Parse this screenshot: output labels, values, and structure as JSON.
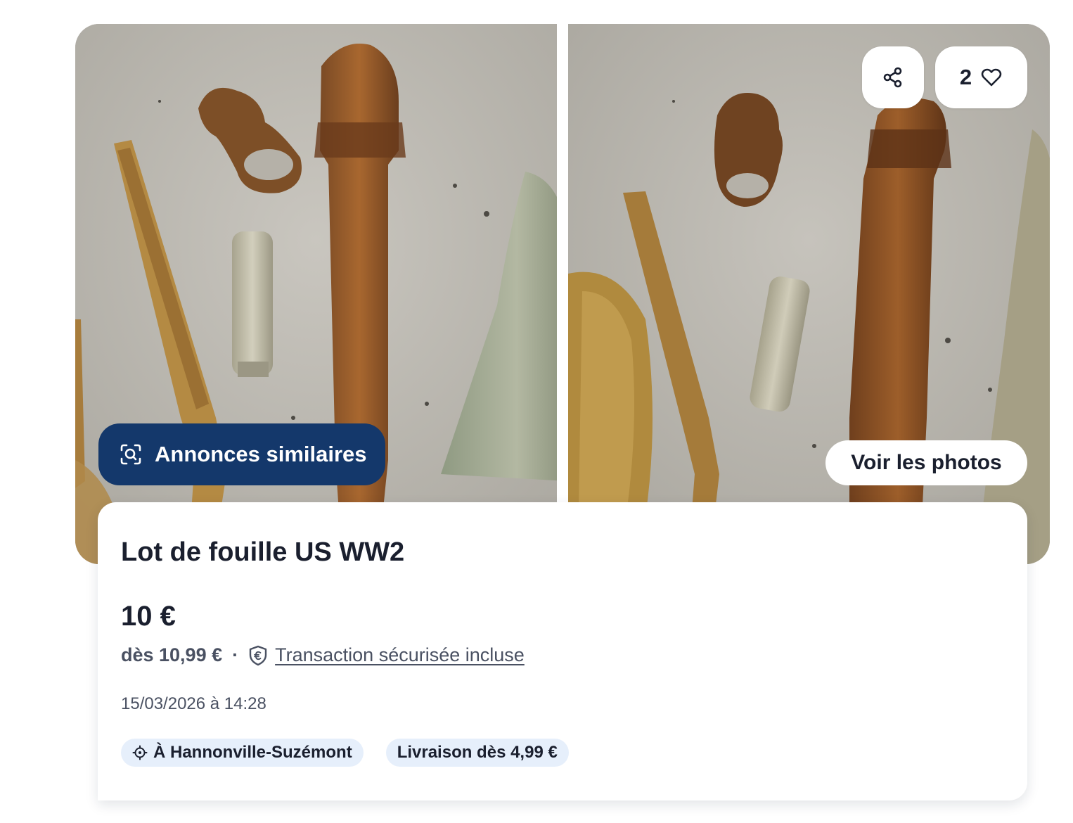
{
  "gallery": {
    "left_photo_alt": "",
    "right_photo_alt": "",
    "similar_label": "Annonces similaires",
    "similar_icon": "image-search-icon",
    "share_icon": "share-icon",
    "favorites_count": "2",
    "favorite_icon": "heart-icon",
    "see_photos_label": "Voir les photos"
  },
  "listing": {
    "title": "Lot de fouille US WW2",
    "price": "10 €",
    "price_from": "dès 10,99 €",
    "separator": "·",
    "secure_icon": "shield-euro-icon",
    "secure_label": "Transaction sécurisée incluse",
    "date": "15/03/2026 à 14:28",
    "location_icon": "location-target-icon",
    "location": "À Hannonville-Suzémont",
    "delivery": "Livraison dès 4,99 €"
  },
  "colors": {
    "primary": "#14386b",
    "chip_bg": "#e6effb",
    "text": "#1a1f2e",
    "muted": "#4a5162"
  }
}
